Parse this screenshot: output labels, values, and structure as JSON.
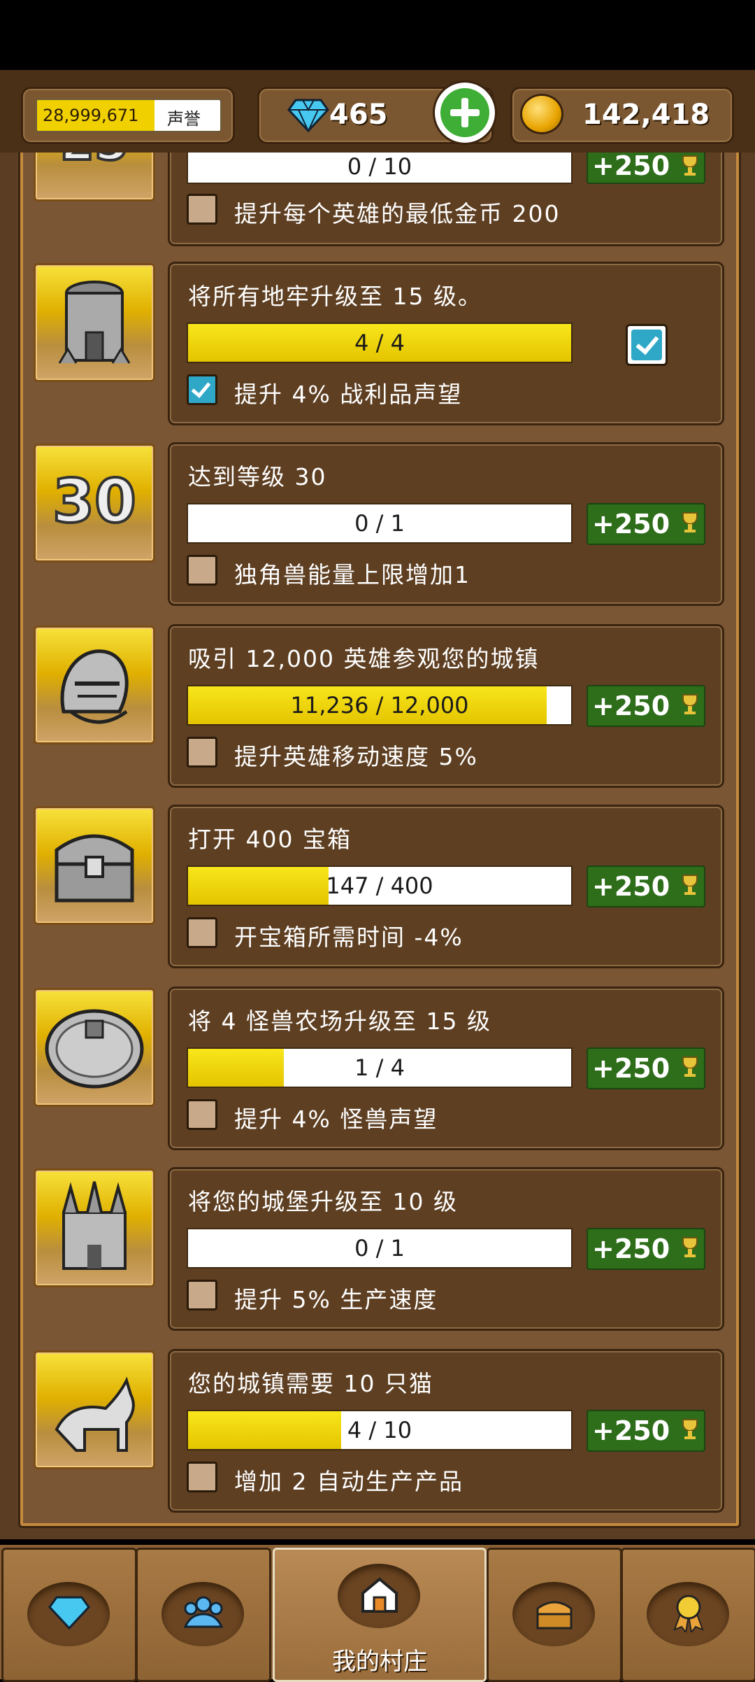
{
  "header": {
    "reputation_value": "28,999,671",
    "reputation_label": "声誉",
    "gems": "465",
    "gold": "142,418"
  },
  "quests": [
    {
      "icon": "level-25-icon",
      "title": "",
      "progress_text": "0 / 10",
      "progress": 0,
      "reward": "+250",
      "bonus": "提升每个英雄的最低金币 200",
      "bonus_checked": false,
      "claimed": false
    },
    {
      "icon": "dungeon-tower-icon",
      "title": "将所有地牢升级至 15 级。",
      "progress_text": "4 / 4",
      "progress": 1.0,
      "reward": "",
      "bonus": "提升 4% 战利品声望",
      "bonus_checked": true,
      "claimed": true
    },
    {
      "icon": "level-30-icon",
      "icon_text": "30",
      "title": "达到等级 30",
      "progress_text": "0 / 1",
      "progress": 0,
      "reward": "+250",
      "bonus": "独角兽能量上限增加1",
      "bonus_checked": false,
      "claimed": false
    },
    {
      "icon": "knight-helmet-icon",
      "title": "吸引 12,000 英雄参观您的城镇",
      "progress_text": "11,236 / 12,000",
      "progress": 0.936,
      "reward": "+250",
      "bonus": "提升英雄移动速度 5%",
      "bonus_checked": false,
      "claimed": false
    },
    {
      "icon": "treasure-chest-icon",
      "title": "打开 400 宝箱",
      "progress_text": "147 / 400",
      "progress": 0.3675,
      "reward": "+250",
      "bonus": "开宝箱所需时间 -4%",
      "bonus_checked": false,
      "claimed": false
    },
    {
      "icon": "monster-farm-icon",
      "title": "将 4 怪兽农场升级至 15 级",
      "progress_text": "1 / 4",
      "progress": 0.25,
      "reward": "+250",
      "bonus": "提升 4% 怪兽声望",
      "bonus_checked": false,
      "claimed": false
    },
    {
      "icon": "castle-icon",
      "title": "将您的城堡升级至 10 级",
      "progress_text": "0 / 1",
      "progress": 0,
      "reward": "+250",
      "bonus": "提升 5% 生产速度",
      "bonus_checked": false,
      "claimed": false
    },
    {
      "icon": "cat-icon",
      "title": "您的城镇需要 10 只猫",
      "progress_text": "4 / 10",
      "progress": 0.4,
      "reward": "+250",
      "bonus": "增加 2 自动生产产品",
      "bonus_checked": false,
      "claimed": false
    }
  ],
  "nav": {
    "village_label": "我的村庄"
  }
}
